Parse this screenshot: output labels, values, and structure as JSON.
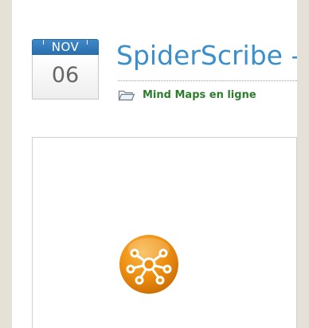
{
  "post": {
    "date": {
      "month": "NOV",
      "day": "06"
    },
    "title": "SpiderScribe -",
    "category": {
      "label": "Mind Maps en ligne",
      "icon": "folder-icon"
    }
  },
  "image": {
    "icon": "spiderscribe-logo-icon"
  },
  "colors": {
    "background": "#e6e1d6",
    "title": "#3b8fcb",
    "category_link": "#2e7d2e",
    "month_bar": "#2f78b8",
    "logo": "#ee8e0f"
  }
}
